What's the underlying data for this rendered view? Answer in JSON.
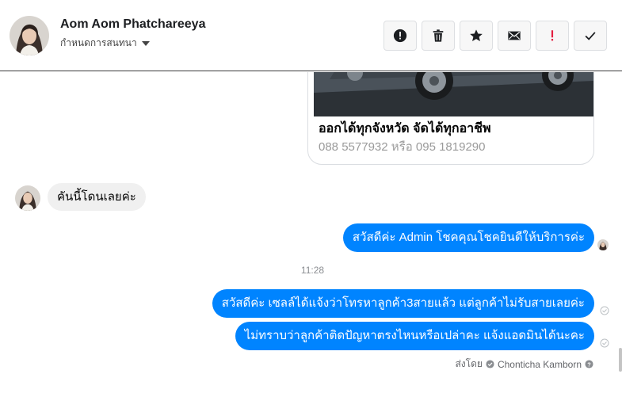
{
  "header": {
    "contact_name": "Aom Aom Phatchareeya",
    "status_label": "กำหนดการสนทนา",
    "toolbar": [
      {
        "name": "report-button",
        "icon": "alert-circle-icon",
        "color": "#1c1e21"
      },
      {
        "name": "delete-button",
        "icon": "trash-icon",
        "color": "#1c1e21"
      },
      {
        "name": "star-button",
        "icon": "star-icon",
        "color": "#1c1e21"
      },
      {
        "name": "mark-unread-button",
        "icon": "envelope-icon",
        "color": "#1c1e21"
      },
      {
        "name": "important-button",
        "icon": "exclamation-icon",
        "color": "#e41e3f"
      },
      {
        "name": "mark-done-button",
        "icon": "checkmark-icon",
        "color": "#1c1e21"
      }
    ]
  },
  "card": {
    "title": "ออกได้ทุกจังหวัด จัดได้ทุกอาชีพ",
    "subtitle": "088 5577932 หรือ 095 1819290"
  },
  "messages": {
    "incoming_1": "คันนี้โดนเลยค่ะ",
    "outgoing_1": "สวัสดีค่ะ Admin โชคคุณโชคยินดีให้บริการค่ะ",
    "time_separator": "11:28",
    "outgoing_2": "สวัสดีค่ะ เซลล์ได้แจ้งว่าโทรหาลูกค้า3สายแล้ว แต่ลูกค้าไม่รับสายเลยค่ะ",
    "outgoing_3": "ไม่ทราบว่าลูกค้าติดปัญหาตรงไหนหรือเปล่าคะ แจ้งแอดมินได้นะคะ"
  },
  "sent_by": {
    "label": "ส่งโดย",
    "name": "Chonticha Kamborn"
  },
  "colors": {
    "outgoing_bubble": "#0084ff",
    "incoming_bubble": "#f0f0f0",
    "important": "#e41e3f"
  }
}
